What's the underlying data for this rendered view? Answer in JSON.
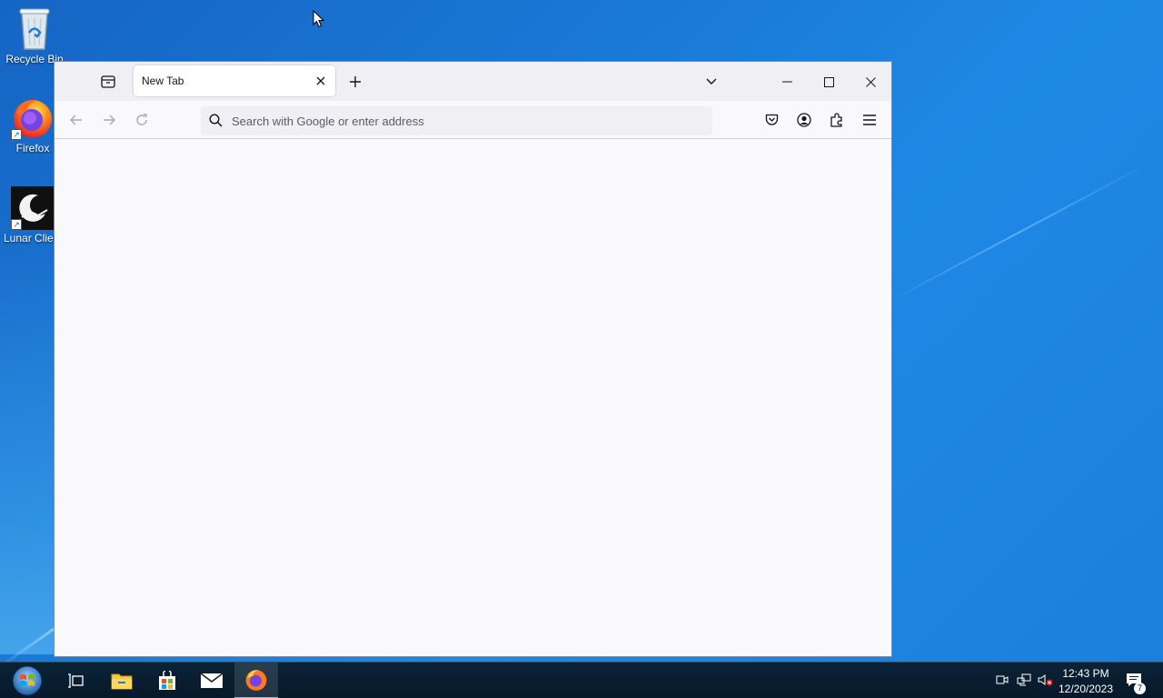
{
  "desktop": {
    "icons": [
      {
        "label": "Recycle Bin",
        "icon": "recycle-bin-icon"
      },
      {
        "label": "Firefox",
        "icon": "firefox-icon"
      },
      {
        "label": "Lunar Client",
        "icon": "lunar-client-icon"
      }
    ]
  },
  "browser": {
    "tab": {
      "title": "New Tab"
    },
    "urlbar": {
      "placeholder": "Search with Google or enter address",
      "value": ""
    }
  },
  "taskbar": {
    "clock": {
      "time": "12:43 PM",
      "date": "12/20/2023"
    },
    "notification_count": "7"
  },
  "colors": {
    "desktop_bg": "#1a78d6",
    "window_bg": "#f9f9fb",
    "tabbar_bg": "#f0f0f4",
    "taskbar_bg": "#0b2236"
  }
}
